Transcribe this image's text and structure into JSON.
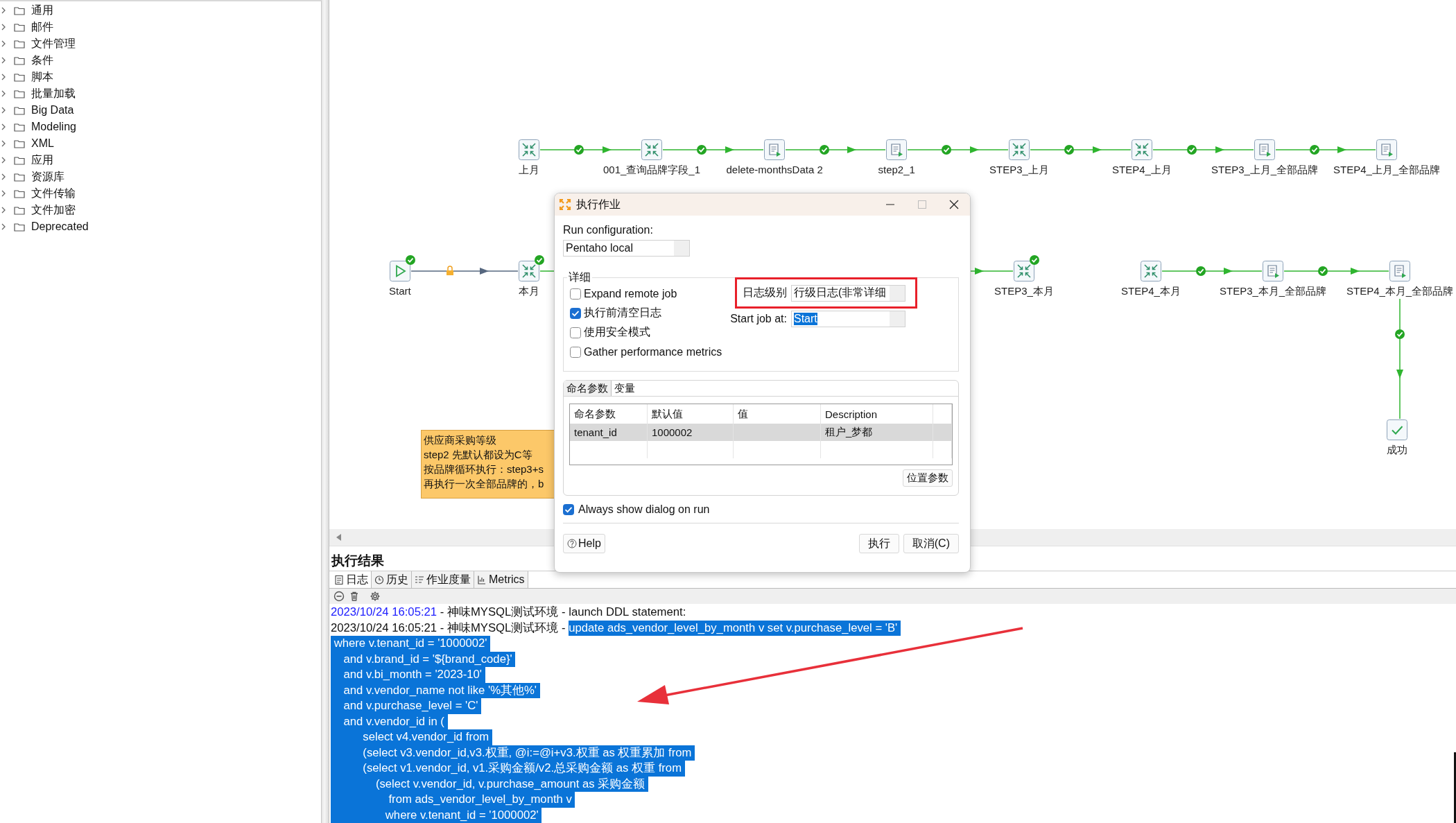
{
  "sidebar": {
    "items": [
      {
        "label": "通用",
        "expanded": false
      },
      {
        "label": "邮件",
        "expanded": false
      },
      {
        "label": "文件管理",
        "expanded": false
      },
      {
        "label": "条件",
        "expanded": false
      },
      {
        "label": "脚本",
        "expanded": false
      },
      {
        "label": "批量加载",
        "expanded": false
      },
      {
        "label": "Big Data",
        "expanded": false
      },
      {
        "label": "Modeling",
        "expanded": false
      },
      {
        "label": "XML",
        "expanded": false
      },
      {
        "label": "应用",
        "expanded": false
      },
      {
        "label": "资源库",
        "expanded": false
      },
      {
        "label": "文件传输",
        "expanded": false
      },
      {
        "label": "文件加密",
        "expanded": false
      },
      {
        "label": "Deprecated",
        "expanded": false
      }
    ]
  },
  "canvas": {
    "nodes": [
      {
        "label": "上月",
        "kind": "job",
        "done": false,
        "outgoing_hop": {
          "kind": "success"
        }
      },
      {
        "label": "001_查询品牌字段_1",
        "kind": "job",
        "done": false,
        "outgoing_hop": {
          "kind": "success"
        }
      },
      {
        "label": "delete-monthsData 2",
        "kind": "sql",
        "done": false,
        "outgoing_hop": {
          "kind": "success"
        }
      },
      {
        "label": "step2_1",
        "kind": "sql",
        "done": false,
        "outgoing_hop": {
          "kind": "success"
        }
      },
      {
        "label": "STEP3_上月",
        "kind": "job",
        "done": false,
        "outgoing_hop": {
          "kind": "success"
        }
      },
      {
        "label": "STEP4_上月",
        "kind": "job",
        "done": false,
        "outgoing_hop": {
          "kind": "success"
        }
      },
      {
        "label": "STEP3_上月_全部品牌",
        "kind": "sql",
        "done": false,
        "outgoing_hop": {
          "kind": "success"
        }
      },
      {
        "label": "STEP4_上月_全部品牌",
        "kind": "sql",
        "done": false
      },
      {
        "label": "Start",
        "kind": "start",
        "done": true,
        "outgoing_hop": {
          "kind": "unconditional"
        }
      },
      {
        "label": "本月",
        "kind": "job",
        "done": true,
        "outgoing_hop": {
          "kind": "success"
        }
      },
      {
        "label": "STEP3_本月",
        "kind": "job",
        "done": true
      },
      {
        "label": "STEP4_本月",
        "kind": "job",
        "done": false,
        "outgoing_hop": {
          "kind": "success"
        }
      },
      {
        "label": "STEP3_本月_全部品牌",
        "kind": "sql",
        "done": false,
        "outgoing_hop": {
          "kind": "success"
        }
      },
      {
        "label": "STEP4_本月_全部品牌",
        "kind": "sql",
        "done": false,
        "outgoing_hop": {
          "kind": "success"
        }
      },
      {
        "label": "成功",
        "kind": "success",
        "done": false
      }
    ],
    "note": {
      "lines": [
        "供应商采购等级",
        "step2 先默认都设为C等",
        "按品牌循环执行：step3+s",
        "再执行一次全部品牌的，b"
      ]
    }
  },
  "dialog": {
    "title": "执行作业",
    "run_configuration": {
      "label": "Run configuration:",
      "value": "Pentaho local"
    },
    "details": {
      "title": "详细",
      "options": [
        {
          "label": "Expand remote job",
          "checked": false
        },
        {
          "label": "执行前清空日志",
          "checked": true
        },
        {
          "label": "使用安全模式",
          "checked": false
        },
        {
          "label": "Gather performance metrics",
          "checked": false
        }
      ],
      "log_level": {
        "label": "日志级别",
        "value": "行级日志(非常详细"
      },
      "start_job_at": {
        "label": "Start job at:",
        "value": "Start",
        "selected": true
      }
    },
    "tabs": [
      {
        "label": "命名参数",
        "selected": true
      },
      {
        "label": "变量",
        "selected": false
      }
    ],
    "parameters": {
      "columns": [
        "命名参数",
        "默认值",
        "值",
        "Description"
      ],
      "rows": [
        {
          "name": "tenant_id",
          "default": "1000002",
          "description": "租户_梦都",
          "selected": true
        }
      ]
    },
    "positional_button": "位置参数",
    "always_show": {
      "label": "Always show dialog on run",
      "checked": true
    },
    "help_button": "Help",
    "buttons": [
      "执行",
      "取消(C)"
    ]
  },
  "results": {
    "title": "执行结果",
    "tabs": [
      {
        "label": "日志",
        "kind": "log",
        "selected": true
      },
      {
        "label": "历史",
        "kind": "history",
        "selected": false
      },
      {
        "label": "作业度量",
        "kind": "metrics-list",
        "selected": false
      },
      {
        "label": "Metrics",
        "kind": "chart",
        "selected": false
      }
    ],
    "log": [
      {
        "segments": [
          {
            "text": "2023/10/24 16:05:21",
            "color": "#2020ff",
            "selected": false
          },
          {
            "text": " - 神味MYSQL测试环境 - launch DDL statement:",
            "selected": false
          }
        ]
      },
      {
        "segments": [
          {
            "text": "2023/10/24 16:05:21 - 神味MYSQL测试环境 - ",
            "selected": false
          },
          {
            "text": "update ads_vendor_level_by_month v set v.purchase_level = 'B' ",
            "selected": true
          }
        ]
      },
      {
        "segments": [
          {
            "text": " where v.tenant_id = '1000002' ",
            "selected": true
          }
        ]
      },
      {
        "segments": [
          {
            "text": "    and v.brand_id = '${brand_code}' ",
            "selected": true
          }
        ]
      },
      {
        "segments": [
          {
            "text": "    and v.bi_month = '2023-10' ",
            "selected": true
          }
        ]
      },
      {
        "segments": [
          {
            "text": "    and v.vendor_name not like '%其他%' ",
            "selected": true
          }
        ]
      },
      {
        "segments": [
          {
            "text": "    and v.purchase_level = 'C' ",
            "selected": true
          }
        ]
      },
      {
        "segments": [
          {
            "text": "    and v.vendor_id in ( ",
            "selected": true
          }
        ]
      },
      {
        "segments": [
          {
            "text": "          select v4.vendor_id from ",
            "selected": true
          }
        ]
      },
      {
        "segments": [
          {
            "text": "          (select v3.vendor_id,v3.权重, @i:=@i+v3.权重 as 权重累加 from ",
            "selected": true
          }
        ]
      },
      {
        "segments": [
          {
            "text": "          (select v1.vendor_id, v1.采购金额/v2.总采购金额 as 权重 from ",
            "selected": true
          }
        ]
      },
      {
        "segments": [
          {
            "text": "              (select v.vendor_id, v.purchase_amount as 采购金额 ",
            "selected": true
          }
        ]
      },
      {
        "segments": [
          {
            "text": "                  from ads_vendor_level_by_month v ",
            "selected": true
          }
        ]
      },
      {
        "segments": [
          {
            "text": "                 where v.tenant_id = '1000002' ",
            "selected": true
          }
        ]
      }
    ]
  }
}
